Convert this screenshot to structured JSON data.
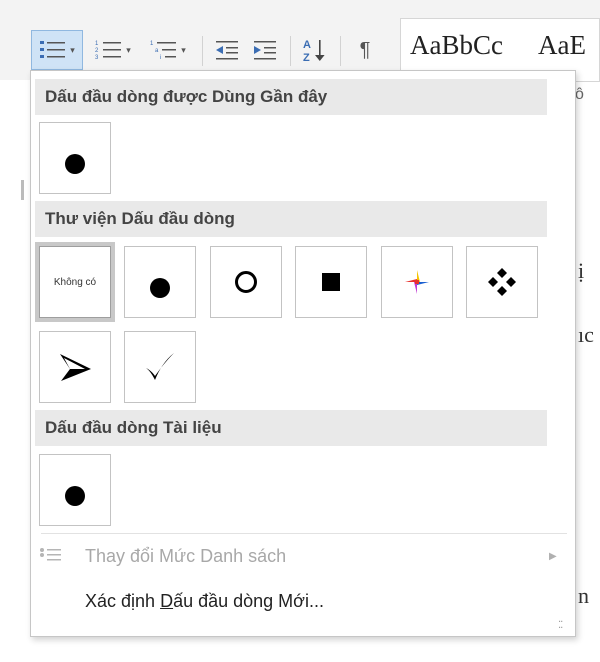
{
  "document_text": {
    "line1": "ị",
    "line2": "ıc",
    "line3": "n"
  },
  "styles_gallery": {
    "sample_1": "AaBbCc",
    "sample_2": "AaE",
    "sample_subline": "ô"
  },
  "dropdown": {
    "recent": {
      "header": "Dấu đầu dòng được Dùng Gần đây",
      "items": [
        {
          "symbol": "solid-dot"
        }
      ]
    },
    "library": {
      "header": "Thư viện Dấu đầu dòng",
      "none_label": "Không có",
      "items": [
        {
          "symbol": "none",
          "selected": true
        },
        {
          "symbol": "solid-dot"
        },
        {
          "symbol": "hollow-circle"
        },
        {
          "symbol": "solid-square"
        },
        {
          "symbol": "colorful-pinwheel"
        },
        {
          "symbol": "diamond-cluster"
        },
        {
          "symbol": "arrowhead"
        },
        {
          "symbol": "checkmark"
        }
      ]
    },
    "document": {
      "header": "Dấu đầu dòng Tài liệu",
      "items": [
        {
          "symbol": "solid-dot"
        }
      ]
    },
    "menu": {
      "change_level": {
        "label": "Thay đổi Mức Danh sách",
        "enabled": false
      },
      "define_new": {
        "label_before": "Xác định ",
        "label_accel": "D",
        "label_after": "ấu đầu dòng Mới...",
        "enabled": true
      }
    }
  },
  "colors": {
    "section_header_bg": "#e9e9e9",
    "ribbon_icon": "#3b6db3",
    "active_button_bg": "#cfe3f6",
    "pinwheel": [
      "#e8322d",
      "#1a5fd1",
      "#f5c400",
      "#c03bd4"
    ]
  }
}
